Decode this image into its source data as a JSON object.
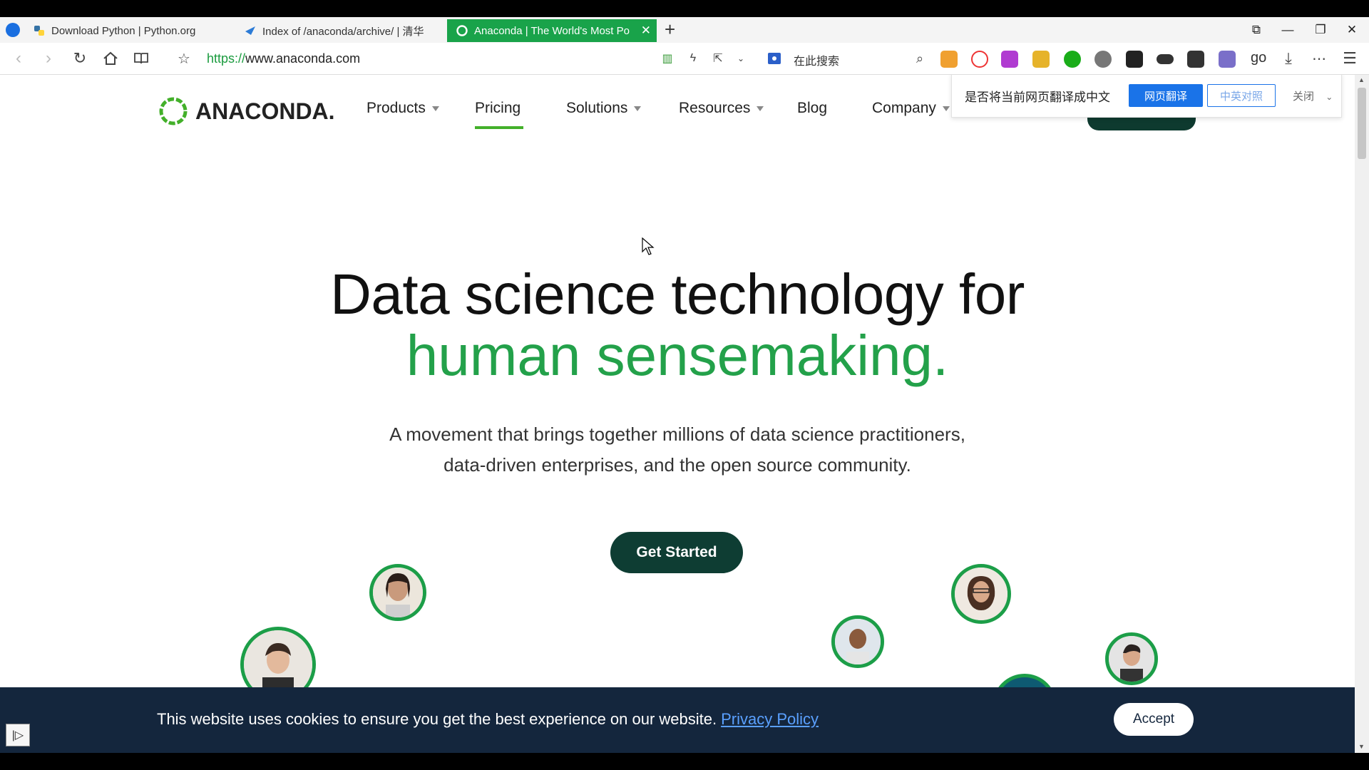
{
  "browser": {
    "tabs": [
      {
        "title": "Download Python | Python.org"
      },
      {
        "title": "Index of /anaconda/archive/ | 清华"
      },
      {
        "title": "Anaconda | The World's Most Po"
      }
    ],
    "new_tab_label": "+",
    "url_scheme": "https://",
    "url_host": "www.anaconda.com",
    "search_placeholder": "在此搜索",
    "accent_color": "#19a34a"
  },
  "translate_bar": {
    "message": "是否将当前网页翻译成中文",
    "translate_button": "网页翻译",
    "bilingual_button": "中英对照",
    "close_label": "关闭"
  },
  "site": {
    "logo_text": "ANACONDA.",
    "nav": [
      {
        "label": "Products"
      },
      {
        "label": "Pricing"
      },
      {
        "label": "Solutions"
      },
      {
        "label": "Resources"
      },
      {
        "label": "Blog"
      },
      {
        "label": "Company"
      }
    ],
    "hero": {
      "line1": "Data science technology for",
      "line2": "human sensemaking.",
      "sub1": "A movement that brings together millions of data science practitioners,",
      "sub2": "data-driven enterprises, and the open source community.",
      "cta": "Get Started"
    },
    "brand_green": "#43b02a",
    "dark_green": "#0e3d33"
  },
  "cookie": {
    "message": "This website uses cookies to ensure you get the best experience on our website.",
    "link": "Privacy Policy",
    "accept": "Accept"
  }
}
